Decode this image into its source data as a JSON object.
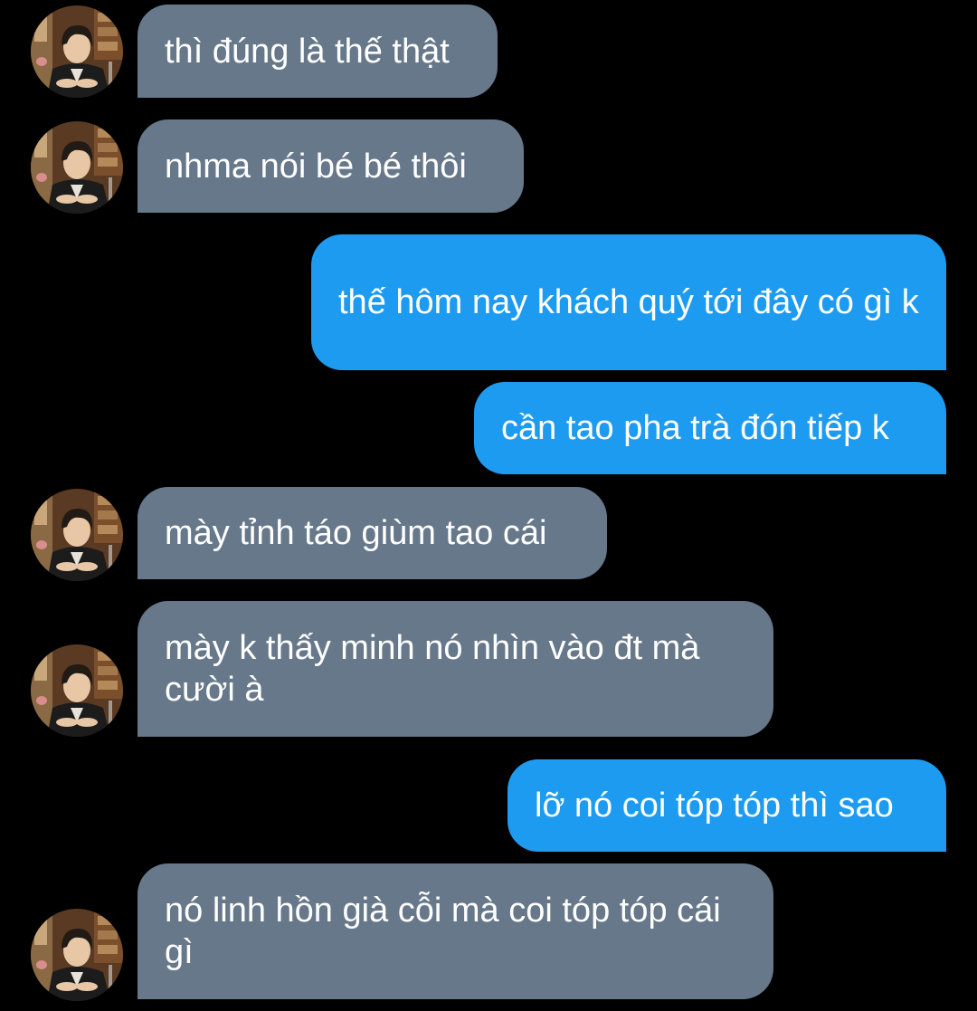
{
  "colors": {
    "background": "#000000",
    "received_bubble": "#66788a",
    "sent_bubble": "#1d9bf0",
    "text": "#ffffff"
  },
  "avatar_icon": "contact-photo",
  "messages": [
    {
      "direction": "received",
      "text": "thì đúng là thế thật"
    },
    {
      "direction": "received",
      "text": "nhma nói bé bé thôi"
    },
    {
      "direction": "sent",
      "text": "thế hôm nay khách quý tới đây có gì k"
    },
    {
      "direction": "sent",
      "text": "cần tao pha trà đón tiếp k"
    },
    {
      "direction": "received",
      "text": "mày tỉnh táo giùm tao cái"
    },
    {
      "direction": "received",
      "text": "mày k thấy minh nó nhìn vào đt mà cười à"
    },
    {
      "direction": "sent",
      "text": "lỡ nó coi tóp tóp thì sao"
    },
    {
      "direction": "received",
      "text": "nó linh hồn già cỗi mà coi tóp tóp cái gì"
    }
  ]
}
